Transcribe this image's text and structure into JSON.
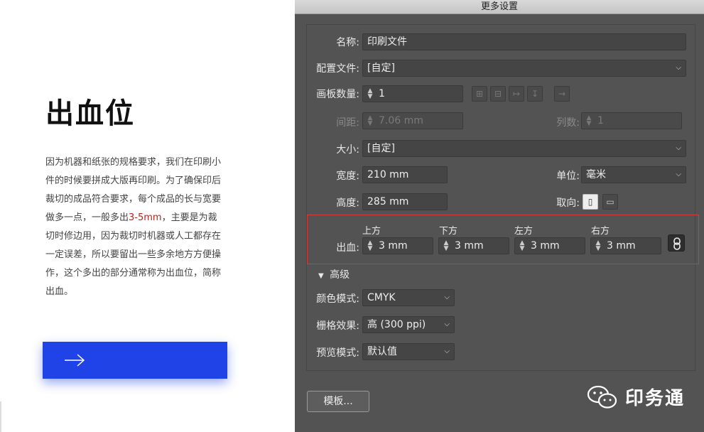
{
  "article": {
    "title": "出血位",
    "body_1": "因为机器和纸张的规格要求，我们在印刷小件的时候要拼成大版再印刷。为了确保印后裁切的成品符合要求，每个成品的长与宽要做多一点，一般多出",
    "body_highlight": "3-5mm",
    "body_2": "，主要是为裁切时修边用，因为裁切时机器或人工都存在一定误差，所以要留出一些多余地方方便操作，这个多出的部分通常称为出血位，简称出血。",
    "highlight_color": "#b3261e",
    "cta_color": "#1f43e6",
    "cta_icon": "arrow-right-icon"
  },
  "dialog": {
    "title": "更多设置",
    "name_label": "名称:",
    "name_value": "印刷文件",
    "profile_label": "配置文件:",
    "profile_value": "[自定]",
    "artboards_label": "画板数量:",
    "artboards_value": "1",
    "spacing_label": "间距:",
    "spacing_value": "7.06 mm",
    "columns_label": "列数:",
    "columns_value": "1",
    "size_label": "大小:",
    "size_value": "[自定]",
    "width_label": "宽度:",
    "width_value": "210 mm",
    "units_label": "单位:",
    "units_value": "毫米",
    "height_label": "高度:",
    "height_value": "285 mm",
    "orientation_label": "取向:",
    "bleed_label": "出血:",
    "bleed": {
      "top_label": "上方",
      "top_value": "3 mm",
      "bottom_label": "下方",
      "bottom_value": "3 mm",
      "left_label": "左方",
      "left_value": "3 mm",
      "right_label": "右方",
      "right_value": "3 mm"
    },
    "advanced_label": "高级",
    "color_mode_label": "颜色模式:",
    "color_mode_value": "CMYK",
    "raster_label": "栅格效果:",
    "raster_value": "高 (300 ppi)",
    "preview_label": "预览模式:",
    "preview_value": "默认值",
    "template_button": "模板..."
  },
  "watermark": {
    "text": "印务通",
    "icon": "wechat-icon"
  }
}
